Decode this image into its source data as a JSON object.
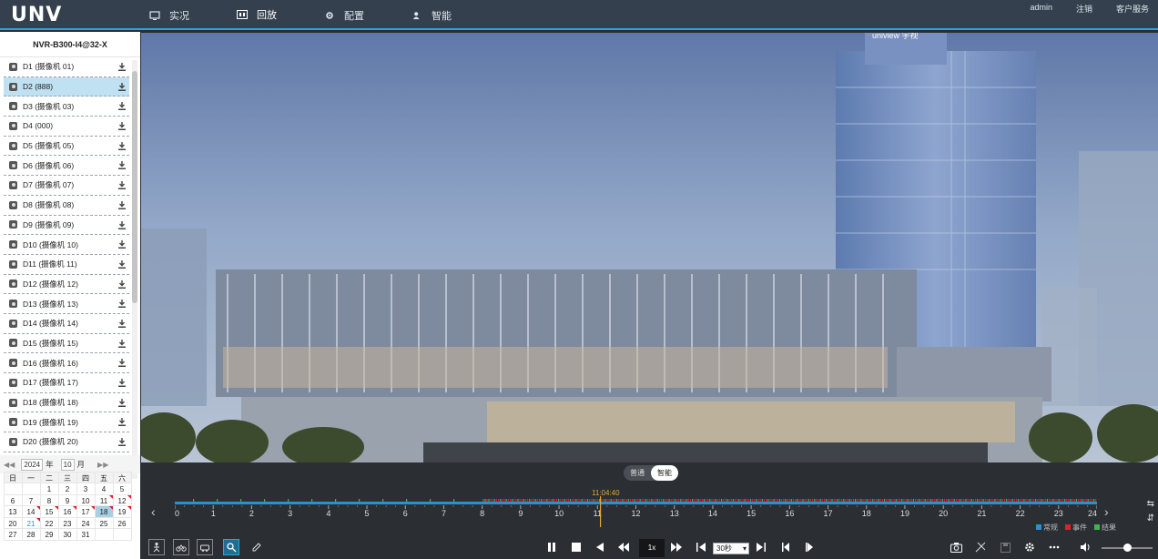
{
  "topbar": {
    "logo": "UNV",
    "nav": [
      {
        "label": "实况",
        "icon": "live-icon",
        "active": false
      },
      {
        "label": "回放",
        "icon": "playback-icon",
        "active": true
      },
      {
        "label": "配置",
        "icon": "gear-icon",
        "active": false
      },
      {
        "label": "智能",
        "icon": "smart-icon",
        "active": false
      }
    ],
    "user": "admin",
    "logout": "注销",
    "service": "客户服务"
  },
  "left": {
    "device": "NVR-B300-I4@32-X",
    "cameras": [
      "D1 (摄像机 01)",
      "D2 (888)",
      "D3 (摄像机 03)",
      "D4 (000)",
      "D5 (摄像机 05)",
      "D6 (摄像机 06)",
      "D7 (摄像机 07)",
      "D8 (摄像机 08)",
      "D9 (摄像机 09)",
      "D10 (摄像机 10)",
      "D11 (摄像机 11)",
      "D12 (摄像机 12)",
      "D13 (摄像机 13)",
      "D14 (摄像机 14)",
      "D15 (摄像机 15)",
      "D16 (摄像机 16)",
      "D17 (摄像机 17)",
      "D18 (摄像机 18)",
      "D19 (摄像机 19)",
      "D20 (摄像机 20)"
    ],
    "selected_camera_index": 1,
    "calendar": {
      "year": "2024",
      "year_label": "年",
      "month": "10",
      "month_label": "月",
      "weekdays": [
        "日",
        "一",
        "二",
        "三",
        "四",
        "五",
        "六"
      ],
      "weeks": [
        [
          "",
          "",
          "1",
          "2",
          "3",
          "4",
          "5"
        ],
        [
          "6",
          "7",
          "8",
          "9",
          "10",
          "11",
          "12"
        ],
        [
          "13",
          "14",
          "15",
          "16",
          "17",
          "18",
          "19"
        ],
        [
          "20",
          "21",
          "22",
          "23",
          "24",
          "25",
          "26"
        ],
        [
          "27",
          "28",
          "29",
          "30",
          "31",
          "",
          ""
        ]
      ],
      "record_days": [
        "11",
        "12",
        "14",
        "15",
        "16",
        "17",
        "18",
        "19",
        "21"
      ],
      "selected_day": "18",
      "today": "21"
    }
  },
  "playback": {
    "mode_normal": "普通",
    "mode_smart": "智能",
    "current_time": "11:04:40",
    "hours": [
      "0",
      "1",
      "2",
      "3",
      "4",
      "5",
      "6",
      "7",
      "8",
      "9",
      "10",
      "11",
      "12",
      "13",
      "14",
      "15",
      "16",
      "17",
      "18",
      "19",
      "20",
      "21",
      "22",
      "23",
      "24"
    ],
    "legend": [
      {
        "label": "常规",
        "color": "#2e8fd0"
      },
      {
        "label": "事件",
        "color": "#e0202b"
      },
      {
        "label": "结果",
        "color": "#3fb34f"
      }
    ],
    "speed": "1x",
    "interval": "30秒"
  }
}
